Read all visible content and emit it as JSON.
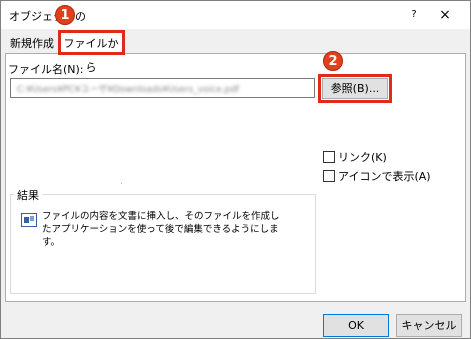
{
  "window": {
    "title": "オブジェクトの",
    "help": "?",
    "close": "×"
  },
  "tabs": [
    {
      "label": "新規作成"
    },
    {
      "label": "ファイルから"
    }
  ],
  "file": {
    "label": "ファイル名(N):",
    "value": "C:¥Users¥PC¥ユーザ¥Downloads¥Users_voice.pdf",
    "browse_label": "参照(B)..."
  },
  "options": {
    "link_label": "リンク(K)",
    "icon_label": "アイコンで表示(A)"
  },
  "result": {
    "title": "結果",
    "text": "ファイルの内容を文書に挿入し、そのファイルを作成したアプリケーションを使って後で編集できるようにします。"
  },
  "buttons": {
    "ok": "OK",
    "cancel": "キャンセル"
  },
  "annotations": {
    "badge1": "1",
    "badge2": "2"
  },
  "colors": {
    "highlight": "#e02b1b",
    "badge": "#e0401c",
    "ok_border": "#0078d7"
  }
}
